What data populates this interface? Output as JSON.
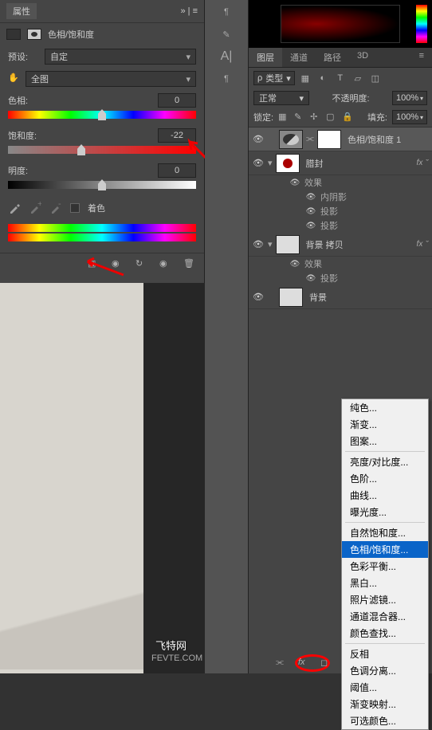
{
  "panel": {
    "title": "属性",
    "type_label": "色相/饱和度",
    "preset_label": "预设:",
    "preset_value": "自定",
    "range_value": "全图",
    "hue_label": "色相:",
    "hue_value": "0",
    "saturation_label": "饱和度:",
    "saturation_value": "-22",
    "lightness_label": "明度:",
    "lightness_value": "0",
    "colorize_label": "着色"
  },
  "layers": {
    "tabs": [
      "图层",
      "通道",
      "路径",
      "3D"
    ],
    "filter_label": "类型",
    "blend_mode": "正常",
    "opacity_label": "不透明度:",
    "opacity_value": "100%",
    "lock_label": "锁定:",
    "fill_label": "填充:",
    "fill_value": "100%",
    "items": [
      {
        "name": "色相/饱和度 1"
      },
      {
        "name": "腊封",
        "fx": true
      },
      {
        "name": "背景 拷贝",
        "fx": true
      },
      {
        "name": "背景"
      }
    ],
    "fx_label": "效果",
    "fx_inner_shadow": "内阴影",
    "fx_drop_shadow": "投影"
  },
  "menu": {
    "items": [
      "纯色...",
      "渐变...",
      "图案...",
      "-",
      "亮度/对比度...",
      "色阶...",
      "曲线...",
      "曝光度...",
      "-",
      "自然饱和度...",
      "色相/饱和度...",
      "色彩平衡...",
      "黑白...",
      "照片滤镜...",
      "通道混合器...",
      "颜色查找...",
      "-",
      "反相",
      "色调分离...",
      "阈值...",
      "渐变映射...",
      "可选颜色..."
    ],
    "highlighted": "色相/饱和度..."
  },
  "watermark": {
    "main": "飞特网",
    "sub": "FEVTE.COM"
  }
}
